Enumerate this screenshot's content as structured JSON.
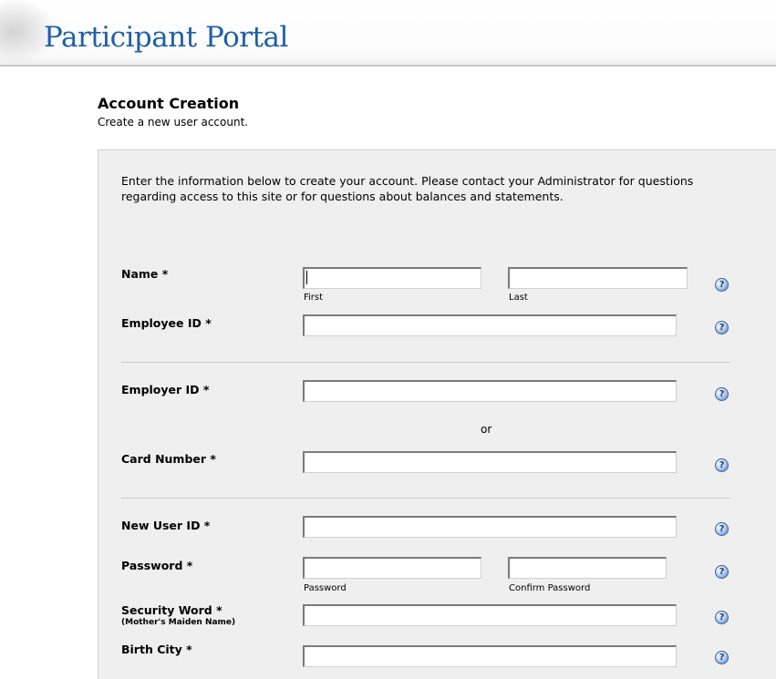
{
  "header": {
    "title": "Participant Portal"
  },
  "section": {
    "title": "Account Creation",
    "subtitle": "Create a new user account."
  },
  "intro": {
    "text": "Enter the information below to create your account. Please contact your Administrator for questions regarding access to this site or for questions about balances and statements."
  },
  "form": {
    "name": {
      "label": "Name *",
      "first_caption": "First",
      "last_caption": "Last",
      "first_value": "",
      "last_value": ""
    },
    "employee_id": {
      "label": "Employee ID *",
      "value": ""
    },
    "employer_id": {
      "label": "Employer ID *",
      "value": ""
    },
    "or_text": "or",
    "card_number": {
      "label": "Card Number *",
      "value": ""
    },
    "new_user_id": {
      "label": "New User ID *",
      "value": ""
    },
    "password": {
      "label": "Password *",
      "password_caption": "Password",
      "confirm_caption": "Confirm Password",
      "value": "",
      "confirm_value": ""
    },
    "security_word": {
      "label": "Security Word *",
      "sublabel": "(Mother's Maiden Name)",
      "value": ""
    },
    "birth_city": {
      "label": "Birth City *",
      "value": ""
    }
  },
  "help_icon": {
    "glyph": "?"
  }
}
